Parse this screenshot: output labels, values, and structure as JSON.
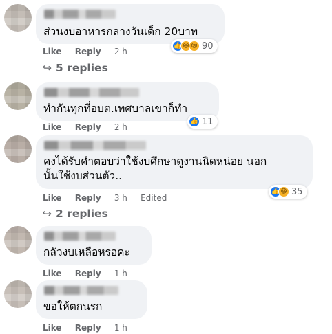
{
  "comments": [
    {
      "text": "ส่วนงบอาหารกลางวันเด็ก 20บาท",
      "actions": {
        "like": "Like",
        "reply": "Reply",
        "time": "2 h"
      },
      "reaction_count": "90",
      "reaction_icons": [
        "like-icon",
        "haha-icon",
        "sad-icon"
      ],
      "replies": "5 replies"
    },
    {
      "text": "ทำกันทุกที่อบต.เทศบาลเขาก็ทำ",
      "actions": {
        "like": "Like",
        "reply": "Reply",
        "time": "2 h"
      },
      "reaction_count": "11",
      "reaction_icons": [
        "like-icon"
      ]
    },
    {
      "text": "คงได้รับคำตอบว่าใช้งบศึกษาดูงานนิดหน่อย นอก\nนั้นใช้งบส่วนตัว..",
      "actions": {
        "like": "Like",
        "reply": "Reply",
        "time": "3 h",
        "edited": "Edited"
      },
      "reaction_count": "35",
      "reaction_icons": [
        "like-icon",
        "haha-icon"
      ],
      "replies": "2 replies"
    },
    {
      "text": "กลัวงบเหลือหรอคะ",
      "actions": {
        "like": "Like",
        "reply": "Reply",
        "time": "1 h"
      }
    },
    {
      "text": "ขอให้ตกนรก",
      "actions": {
        "like": "Like",
        "reply": "Reply",
        "time": "1 h"
      }
    }
  ],
  "colors": {
    "bubble": "#f0f2f5",
    "muted_text": "#65676b",
    "like_blue": "#1877f2",
    "emoji_yellow": "#f7b125"
  }
}
